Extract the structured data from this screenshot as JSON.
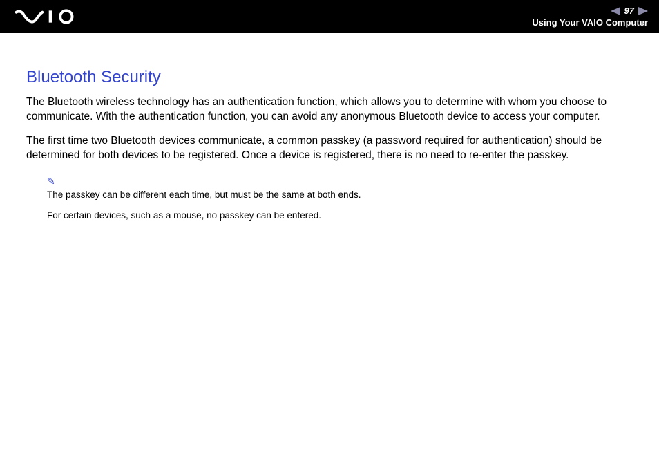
{
  "header": {
    "page_number": "97",
    "section_label": "Using Your VAIO Computer"
  },
  "content": {
    "heading": "Bluetooth Security",
    "paragraph1": "The Bluetooth wireless technology has an authentication function, which allows you to determine with whom you choose to communicate. With the authentication function, you can avoid any anonymous Bluetooth device to access your computer.",
    "paragraph2": "The first time two Bluetooth devices communicate, a common passkey (a password required for authentication) should be determined for both devices to be registered. Once a device is registered, there is no need to re-enter the passkey.",
    "note1": "The passkey can be different each time, but must be the same at both ends.",
    "note2": "For certain devices, such as a mouse, no passkey can be entered."
  }
}
